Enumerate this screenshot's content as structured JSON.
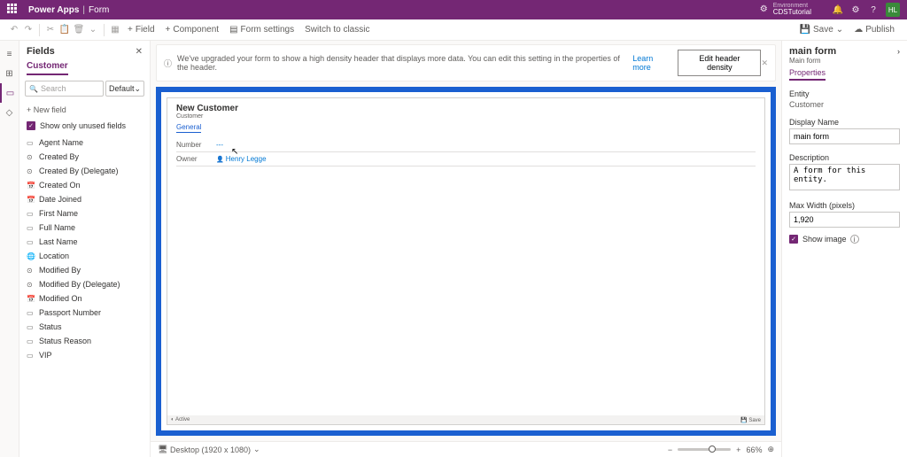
{
  "topbar": {
    "brand": "Power Apps",
    "context": "Form",
    "env_label": "Environment",
    "env_name": "CDSTutorial",
    "avatar_initials": "HL"
  },
  "cmdbar": {
    "field": "Field",
    "component": "Component",
    "form_settings": "Form settings",
    "switch_classic": "Switch to classic",
    "save": "Save",
    "publish": "Publish"
  },
  "fields": {
    "title": "Fields",
    "tab": "Customer",
    "search_placeholder": "Search",
    "default": "Default",
    "new_field": "New field",
    "show_unused": "Show only unused fields",
    "list": [
      "Agent Name",
      "Created By",
      "Created By (Delegate)",
      "Created On",
      "Date Joined",
      "First Name",
      "Full Name",
      "Last Name",
      "Location",
      "Modified By",
      "Modified By (Delegate)",
      "Modified On",
      "Passport Number",
      "Status",
      "Status Reason",
      "VIP"
    ]
  },
  "info": {
    "text": "We've upgraded your form to show a high density header that displays more data. You can edit this setting in the properties of the header.",
    "learn_more": "Learn more",
    "edit_density": "Edit header density"
  },
  "canvas": {
    "form_title": "New Customer",
    "form_sub": "Customer",
    "tab": "General",
    "number_label": "Number",
    "number_value": "---",
    "owner_label": "Owner",
    "owner_value": "Henry Legge",
    "status_left": "Active",
    "status_right": "Save"
  },
  "footer": {
    "device": "Desktop (1920 x 1080)",
    "zoom": "66%"
  },
  "props": {
    "title": "main form",
    "sub": "Main form",
    "tab": "Properties",
    "entity_label": "Entity",
    "entity_value": "Customer",
    "display_name_label": "Display Name",
    "display_name_value": "main form",
    "description_label": "Description",
    "description_value": "A form for this entity.",
    "maxwidth_label": "Max Width (pixels)",
    "maxwidth_value": "1,920",
    "show_image": "Show image"
  }
}
